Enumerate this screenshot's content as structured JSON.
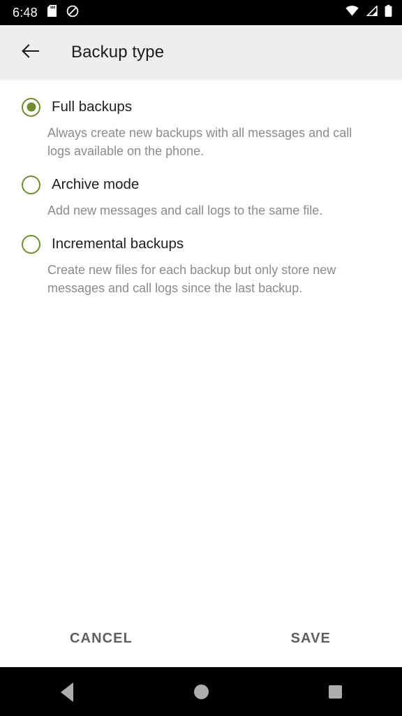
{
  "status_bar": {
    "clock": "6:48",
    "left_icons": [
      "sd-card-icon",
      "do-not-disturb-icon"
    ],
    "right_icons": [
      "wifi-icon",
      "cellular-signal-icon",
      "battery-icon"
    ]
  },
  "app_bar": {
    "back_icon": "arrow-back-icon",
    "title": "Backup type"
  },
  "options": [
    {
      "label": "Full backups",
      "description": "Always create new backups with all messages and call logs available on the phone.",
      "selected": true
    },
    {
      "label": "Archive mode",
      "description": "Add new messages and call logs to the same file.",
      "selected": false
    },
    {
      "label": "Incremental backups",
      "description": "Create new files for each backup but only store new messages and call logs since the last backup.",
      "selected": false
    }
  ],
  "actions": {
    "cancel_label": "CANCEL",
    "save_label": "SAVE"
  },
  "nav_bar": {
    "back": "nav-back-icon",
    "home": "nav-home-icon",
    "recents": "nav-recents-icon"
  },
  "colors": {
    "accent": "#6f8c2e",
    "app_bar_bg": "#eeeeee",
    "label": "#1f1f1f",
    "description": "#8b8b8b",
    "action_text": "#5f5f5f",
    "nav_icon": "#adadad",
    "status_bg": "#000000"
  }
}
